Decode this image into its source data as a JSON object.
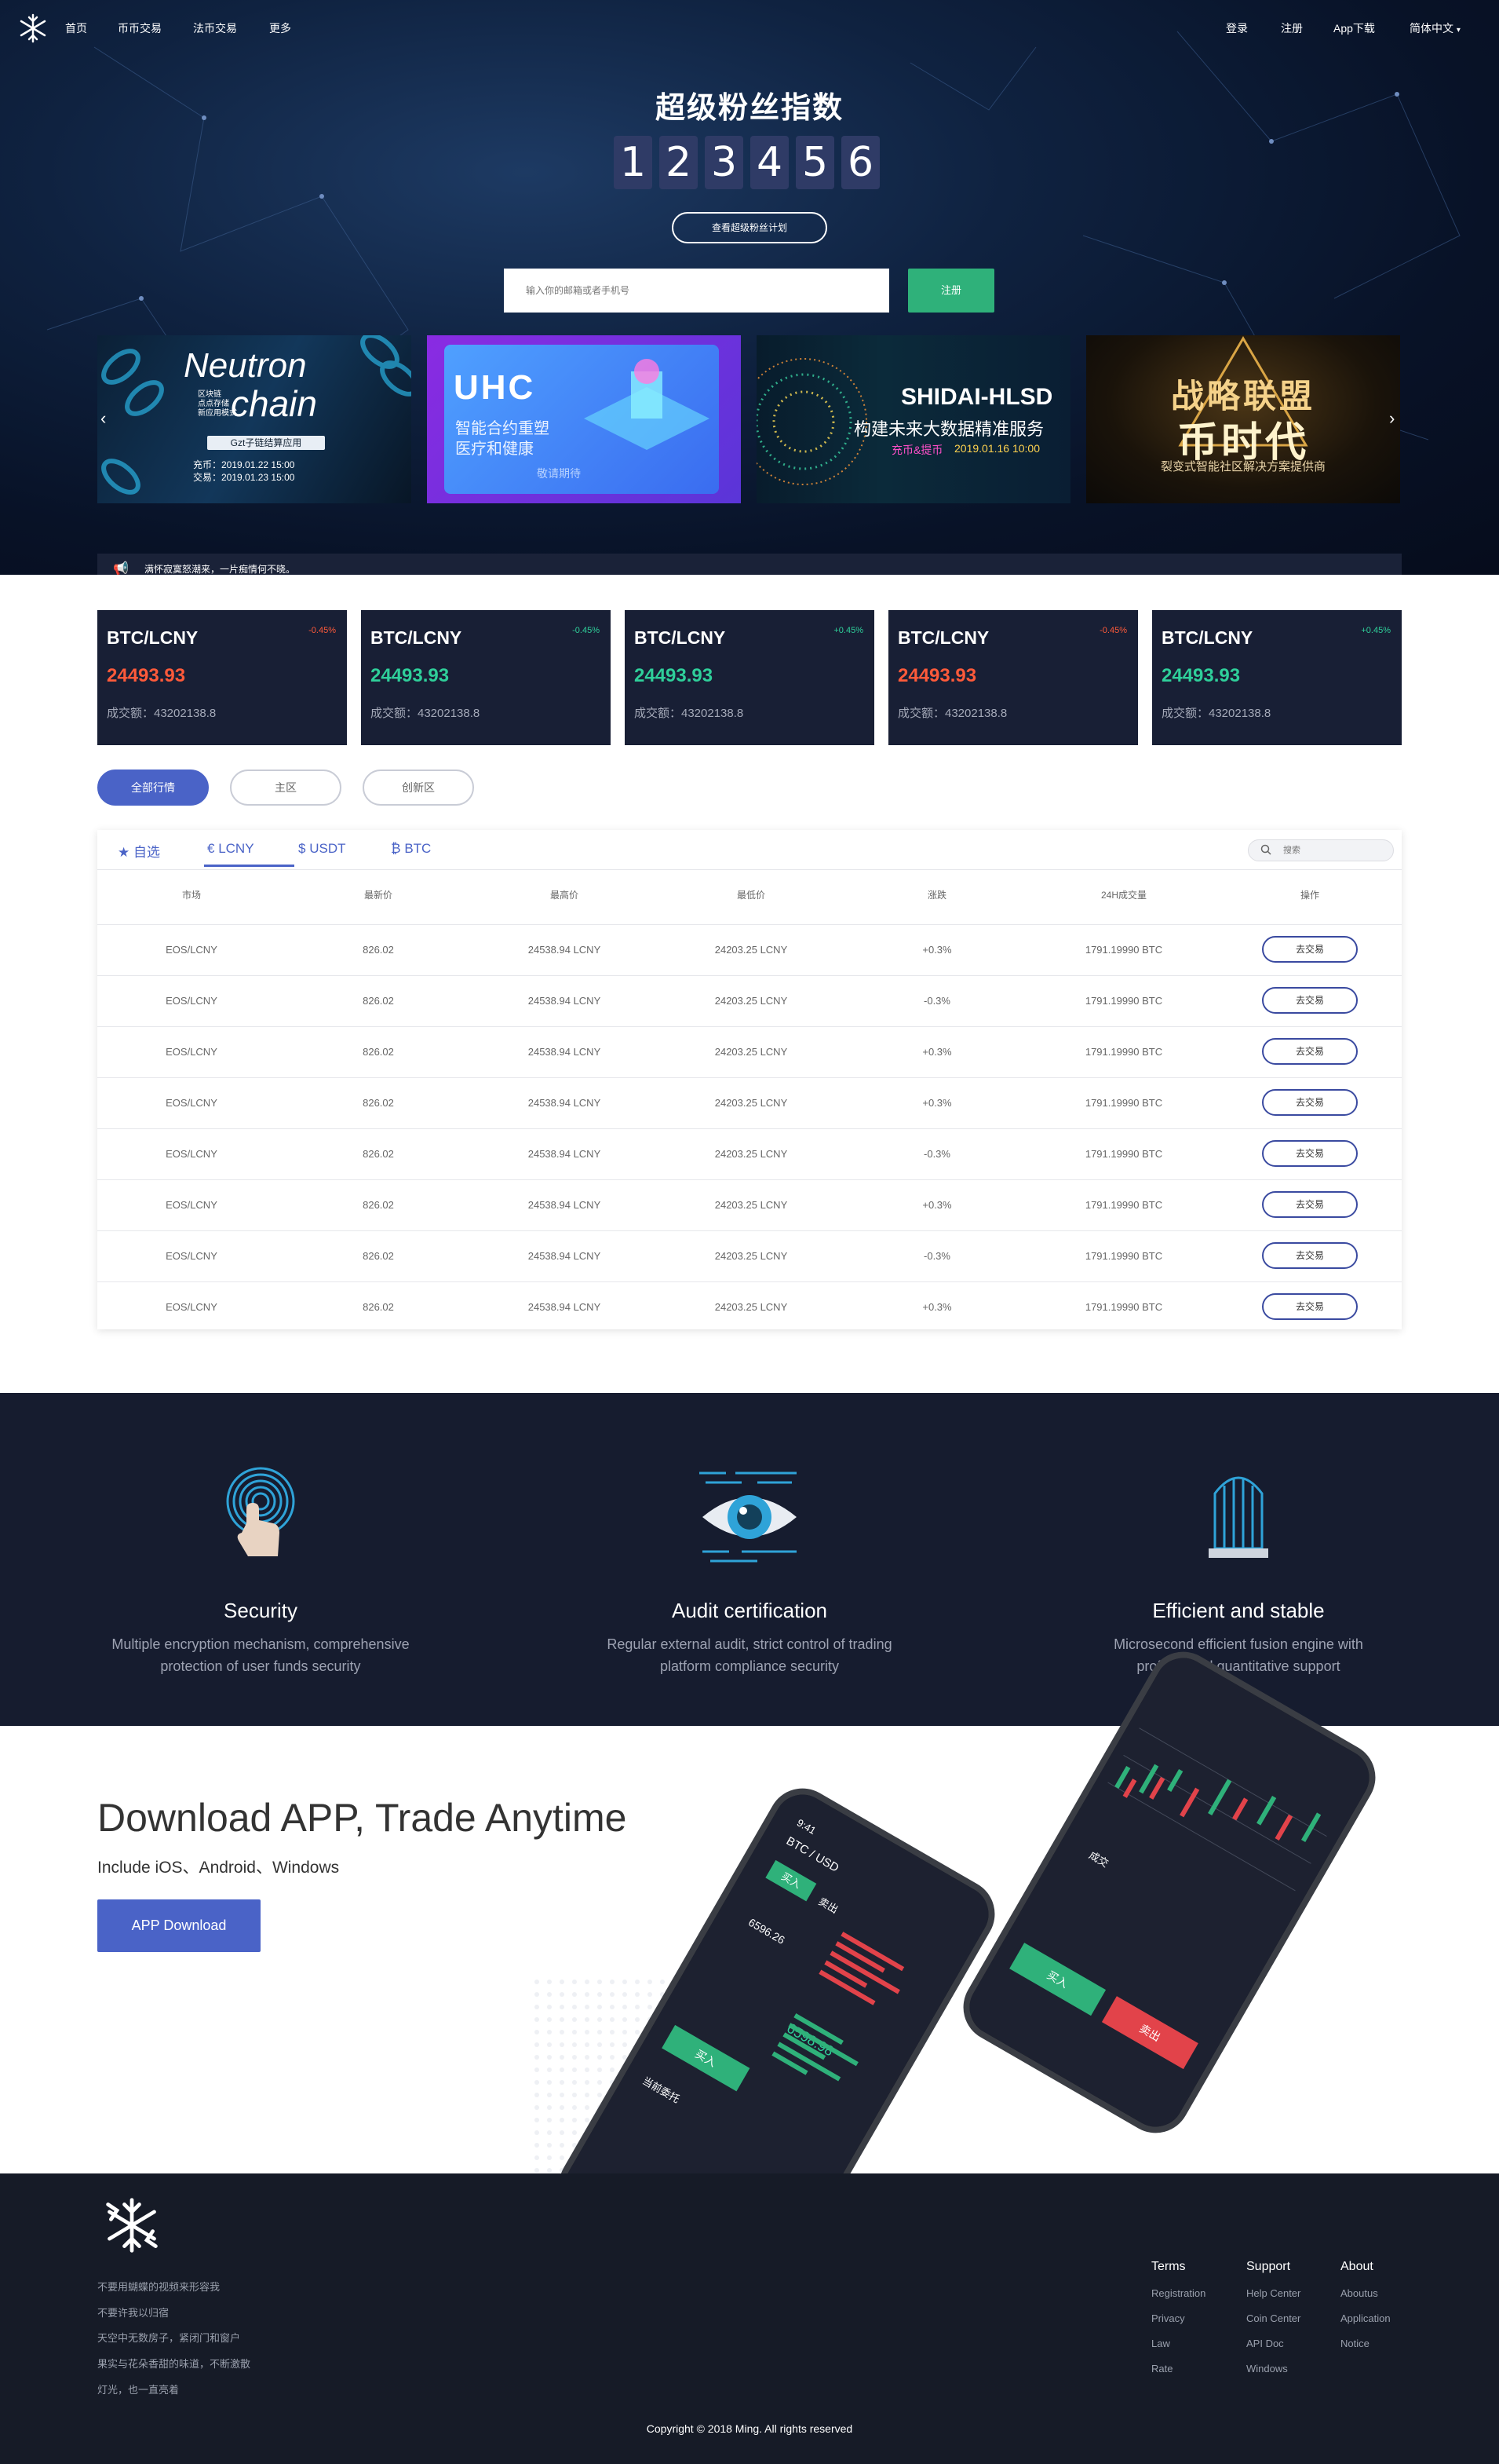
{
  "nav": {
    "left": [
      "首页",
      "币币交易",
      "法币交易",
      "更多"
    ],
    "right": [
      "登录",
      "注册",
      "App下载",
      "简体中文"
    ]
  },
  "hero": {
    "title": "超级粉丝指数",
    "digits": [
      "1",
      "2",
      "3",
      "4",
      "5",
      "6"
    ],
    "plan_button": "查看超级粉丝计划",
    "email_placeholder": "输入你的邮箱或者手机号",
    "register_button": "注册"
  },
  "banners": [
    {
      "title": "Neutron",
      "title2": "chain",
      "side": "区块链\n点点存储\n新应用模式",
      "tag": "Gzt子链结算应用",
      "line1": "充币：2019.01.22 15:00",
      "line2": "交易：2019.01.23 15:00"
    },
    {
      "title": "UHC",
      "line1": "智能合约重塑",
      "line2": "医疗和健康",
      "cta": "敬请期待"
    },
    {
      "title": "SHIDAI-HLSD",
      "line1": "构建未来大数据精准服务",
      "hl": "充币&提币",
      "date": "2019.01.16 10:00"
    },
    {
      "title": "战略联盟",
      "title2": "币时代",
      "line1": "裂变式智能社区解决方案提供商"
    }
  ],
  "notice": "满怀寂寞怒潮来，一片痴情何不晓。",
  "tickers": [
    {
      "pair": "BTC/LCNY",
      "change": "-0.45%",
      "price": "24493.93",
      "volume": "成交额：43202138.8",
      "dir": "down"
    },
    {
      "pair": "BTC/LCNY",
      "change": "-0.45%",
      "price": "24493.93",
      "volume": "成交额：43202138.8",
      "dir": "up"
    },
    {
      "pair": "BTC/LCNY",
      "change": "+0.45%",
      "price": "24493.93",
      "volume": "成交额：43202138.8",
      "dir": "up"
    },
    {
      "pair": "BTC/LCNY",
      "change": "-0.45%",
      "price": "24493.93",
      "volume": "成交额：43202138.8",
      "dir": "down"
    },
    {
      "pair": "BTC/LCNY",
      "change": "+0.45%",
      "price": "24493.93",
      "volume": "成交额：43202138.8",
      "dir": "up"
    }
  ],
  "filters": [
    "全部行情",
    "主区",
    "创新区"
  ],
  "market": {
    "tabs": [
      "自选",
      "LCNY",
      "USDT",
      "BTC"
    ],
    "search_placeholder": "搜索",
    "headers": [
      "市场",
      "最新价",
      "最高价",
      "最低价",
      "涨跌",
      "24H成交量",
      "操作"
    ],
    "rows": [
      [
        "EOS/LCNY",
        "826.02",
        "24538.94 LCNY",
        "24203.25 LCNY",
        "+0.3%",
        "1791.19990 BTC"
      ],
      [
        "EOS/LCNY",
        "826.02",
        "24538.94 LCNY",
        "24203.25 LCNY",
        "-0.3%",
        "1791.19990 BTC"
      ],
      [
        "EOS/LCNY",
        "826.02",
        "24538.94 LCNY",
        "24203.25 LCNY",
        "+0.3%",
        "1791.19990 BTC"
      ],
      [
        "EOS/LCNY",
        "826.02",
        "24538.94 LCNY",
        "24203.25 LCNY",
        "+0.3%",
        "1791.19990 BTC"
      ],
      [
        "EOS/LCNY",
        "826.02",
        "24538.94 LCNY",
        "24203.25 LCNY",
        "-0.3%",
        "1791.19990 BTC"
      ],
      [
        "EOS/LCNY",
        "826.02",
        "24538.94 LCNY",
        "24203.25 LCNY",
        "+0.3%",
        "1791.19990 BTC"
      ],
      [
        "EOS/LCNY",
        "826.02",
        "24538.94 LCNY",
        "24203.25 LCNY",
        "-0.3%",
        "1791.19990 BTC"
      ],
      [
        "EOS/LCNY",
        "826.02",
        "24538.94 LCNY",
        "24203.25 LCNY",
        "+0.3%",
        "1791.19990 BTC"
      ]
    ],
    "action_label": "去交易"
  },
  "features": [
    {
      "icon": "fingerprint-icon",
      "title": "Security",
      "desc1": "Multiple encryption mechanism, comprehensive",
      "desc2": "protection of user funds security"
    },
    {
      "icon": "eye-icon",
      "title": "Audit certification",
      "desc1": "Regular external audit, strict control of trading",
      "desc2": "platform compliance security"
    },
    {
      "icon": "dome-icon",
      "title": "Efficient and stable",
      "desc1": "Microsecond efficient fusion engine with",
      "desc2": "professional quantitative support"
    }
  ],
  "download": {
    "title": "Download APP, Trade Anytime",
    "subtitle": "Include iOS、Android、Windows",
    "button": "APP Download",
    "phone1": {
      "time": "9:41",
      "pair": "BTC / USD",
      "buy": "买入",
      "sell": "卖出",
      "price": "6596.26",
      "price2": "6598.98",
      "current": "当前委托"
    },
    "phone2": {
      "buy": "买入",
      "sell": "卖出",
      "depth": "成交"
    }
  },
  "footer": {
    "lines": [
      "不要用蝴蝶的视频来形容我",
      "不要许我以归宿",
      "天空中无数房子，紧闭门和窗户",
      "果实与花朵香甜的味道，不断激散",
      "灯光，也一直亮着"
    ],
    "cols": [
      {
        "head": "Terms",
        "links": [
          "Registration",
          "Privacy",
          "Law",
          "Rate"
        ]
      },
      {
        "head": "Support",
        "links": [
          "Help Center",
          "Coin Center",
          "API Doc",
          "Windows"
        ]
      },
      {
        "head": "About",
        "links": [
          "Aboutus",
          "Application",
          "Notice"
        ]
      }
    ],
    "copyright": "Copyright © 2018 Ming. All rights reserved"
  },
  "colors": {
    "up": "#2fcf9a",
    "down": "#ff5a3a",
    "accent": "#4a63c7",
    "dark": "#181f35"
  }
}
